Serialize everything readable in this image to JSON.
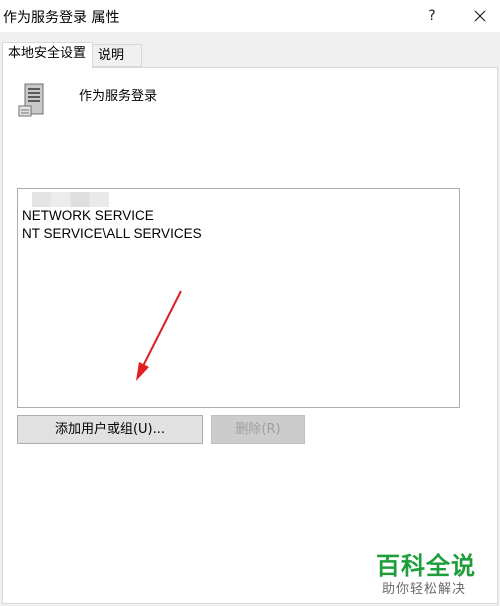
{
  "window": {
    "title": "作为服务登录 属性",
    "help_label": "?"
  },
  "tabs": [
    {
      "label": "本地安全设置",
      "active": true
    },
    {
      "label": "说明",
      "active": false
    }
  ],
  "policy": {
    "name": "作为服务登录",
    "icon": "server-icon"
  },
  "accounts": {
    "items": [
      "NETWORK SERVICE",
      "NT SERVICE\\ALL SERVICES"
    ]
  },
  "buttons": {
    "add_label": "添加用户或组(U)...",
    "remove_label": "删除(R)",
    "remove_enabled": false
  },
  "watermark": {
    "main": "百科全说",
    "sub": "助你轻松解决"
  },
  "colors": {
    "accent": "#1e9e3b",
    "arrow": "#e02020"
  }
}
